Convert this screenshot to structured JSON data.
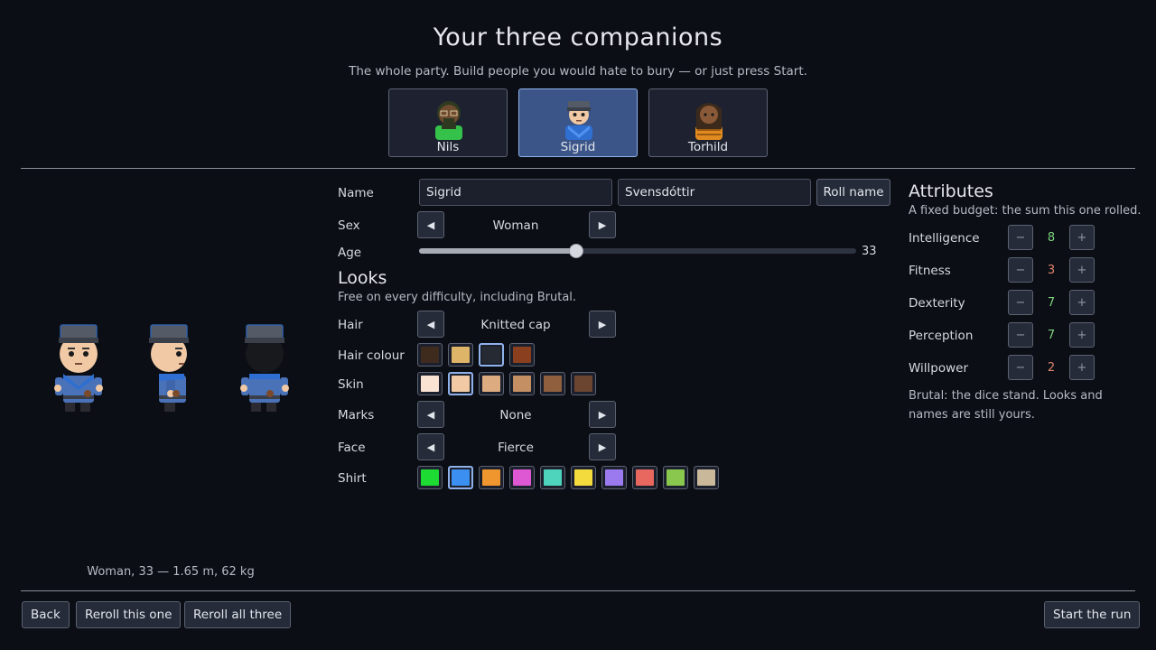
{
  "header": {
    "title": "Your three companions",
    "subtitle": "The whole party. Build people you would hate to bury — or just press Start."
  },
  "companions": [
    {
      "name": "Nils",
      "selected": false,
      "skin": "#6e4a2e",
      "shirt": "#34c24a",
      "hair": "#2e3a20",
      "headwear": "none"
    },
    {
      "name": "Sigrid",
      "selected": true,
      "skin": "#f1c9a5",
      "shirt": "#2f6fd1",
      "hair": "#2b2b33",
      "headwear": "cap"
    },
    {
      "name": "Torhild",
      "selected": false,
      "skin": "#8a5a38",
      "shirt": "#e08a20",
      "hair": "#3b2a1c",
      "headwear": "none"
    }
  ],
  "preview": {
    "summary": "Woman, 33 — 1.65 m, 62 kg",
    "views": [
      "front",
      "side",
      "back"
    ]
  },
  "form": {
    "name_label": "Name",
    "first_name": "Sigrid",
    "last_name": "Svensdóttir",
    "roll_name_label": "Roll name",
    "sex_label": "Sex",
    "sex_value": "Woman",
    "age_label": "Age",
    "age_value": "33",
    "age_fraction": 0.36,
    "prev_icon": "left-triangle",
    "next_icon": "right-triangle"
  },
  "looks": {
    "title": "Looks",
    "note": "Free on every difficulty, including Brutal.",
    "hair_label": "Hair",
    "hair_value": "Knitted cap",
    "hair_colour_label": "Hair colour",
    "hair_colours": [
      "#3e2b1e",
      "#ddb468",
      "#262a33",
      "#8a3f1f"
    ],
    "hair_colour_selected": 2,
    "skin_label": "Skin",
    "skins": [
      "#fbe3d4",
      "#f1c9a5",
      "#ddab80",
      "#c48f63",
      "#8f5f3e",
      "#6b4530"
    ],
    "skin_selected": 1,
    "marks_label": "Marks",
    "marks_value": "None",
    "face_label": "Face",
    "face_value": "Fierce",
    "shirt_label": "Shirt",
    "shirts": [
      "#1edb34",
      "#3a8ff0",
      "#f0962e",
      "#de58d4",
      "#4ed3bd",
      "#f3da3d",
      "#9a7aee",
      "#e8675f",
      "#8ac74f",
      "#c9b89a"
    ],
    "shirt_selected": 1
  },
  "attributes": {
    "title": "Attributes",
    "note": "A fixed budget: the sum this one rolled.",
    "minus": "−",
    "plus": "+",
    "items": [
      {
        "name": "Intelligence",
        "value": "8",
        "color": "#7ed37e"
      },
      {
        "name": "Fitness",
        "value": "3",
        "color": "#e0846e"
      },
      {
        "name": "Dexterity",
        "value": "7",
        "color": "#7ed37e"
      },
      {
        "name": "Perception",
        "value": "7",
        "color": "#7ed37e"
      },
      {
        "name": "Willpower",
        "value": "2",
        "color": "#e0846e"
      }
    ],
    "footnote": "Brutal: the dice stand. Looks and names are still yours."
  },
  "footer": {
    "back": "Back",
    "reroll_one": "Reroll this one",
    "reroll_all": "Reroll all three",
    "start": "Start the run"
  }
}
